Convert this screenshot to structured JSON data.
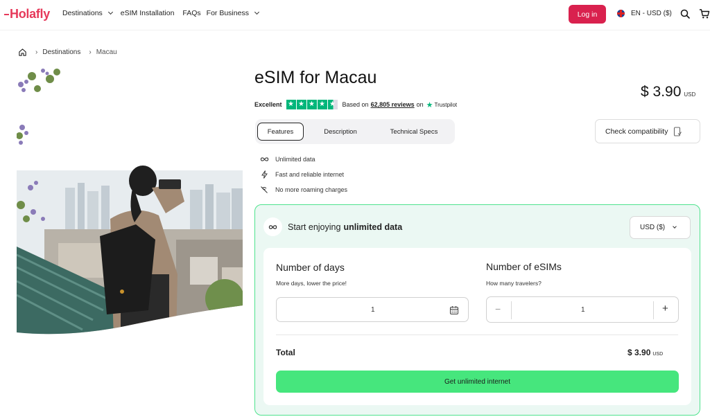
{
  "header": {
    "logo": "Holafly",
    "nav": [
      {
        "label": "Destinations",
        "dropdown": true
      },
      {
        "label": "eSIM Installation",
        "dropdown": false
      },
      {
        "label": "FAQs",
        "dropdown": false
      },
      {
        "label": "For Business",
        "dropdown": true
      }
    ],
    "login_label": "Log in",
    "locale_label": "EN - USD ($)"
  },
  "breadcrumb": [
    "Destinations",
    "Macau"
  ],
  "product": {
    "title": "eSIM for Macau",
    "price": "$ 3.90",
    "price_currency": "USD",
    "rating": {
      "label": "Excellent",
      "stars": 4.5,
      "based_on": "Based on",
      "reviews": "62,805 reviews",
      "on": "on",
      "provider": "Trustpilot"
    },
    "tabs": [
      "Features",
      "Description",
      "Technical Specs"
    ],
    "active_tab": "Features",
    "check_compat_label": "Check compatibility",
    "features": [
      {
        "icon": "infinity-icon",
        "text": "Unlimited data"
      },
      {
        "icon": "lightning-icon",
        "text": "Fast and reliable internet"
      },
      {
        "icon": "no-roaming-icon",
        "text": "No more roaming charges"
      }
    ]
  },
  "plan_card": {
    "heading_prefix": "Start enjoying",
    "heading_bold": "unlimited data",
    "currency_select": "USD ($)",
    "days": {
      "label": "Number of days",
      "sub": "More days, lower the price!",
      "value": "1"
    },
    "esims": {
      "label": "Number of eSIMs",
      "sub": "How many travelers?",
      "value": "1"
    },
    "total_label": "Total",
    "total_value": "$ 3.90",
    "total_currency": "USD",
    "cta_label": "Get unlimited internet"
  },
  "colors": {
    "brand": "#e6395a",
    "login_bg": "#d9214e",
    "cta": "#46e67d",
    "card_border": "#4ee38d",
    "card_bg": "#ebf8f3",
    "trustpilot": "#00b67a"
  }
}
